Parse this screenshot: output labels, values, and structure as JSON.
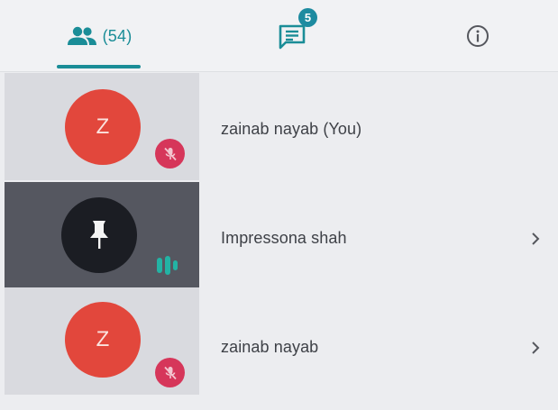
{
  "tabs": {
    "people_count": "(54)",
    "chat_unread": "5"
  },
  "participants": [
    {
      "initial": "Z",
      "name": "zainab nayab (You)",
      "avatar_color": "#e2473c",
      "muted": true
    },
    {
      "initial": "",
      "name": "Impressona shah",
      "avatar_icon": "pin-icon",
      "speaking": true,
      "tile_color": "#555760"
    },
    {
      "initial": "Z",
      "name": "zainab nayab",
      "avatar_color": "#e2473c",
      "muted": true
    }
  ],
  "colors": {
    "accent": "#1a8d97",
    "muted_badge": "#d6365a",
    "avatar": "#e2473c"
  }
}
